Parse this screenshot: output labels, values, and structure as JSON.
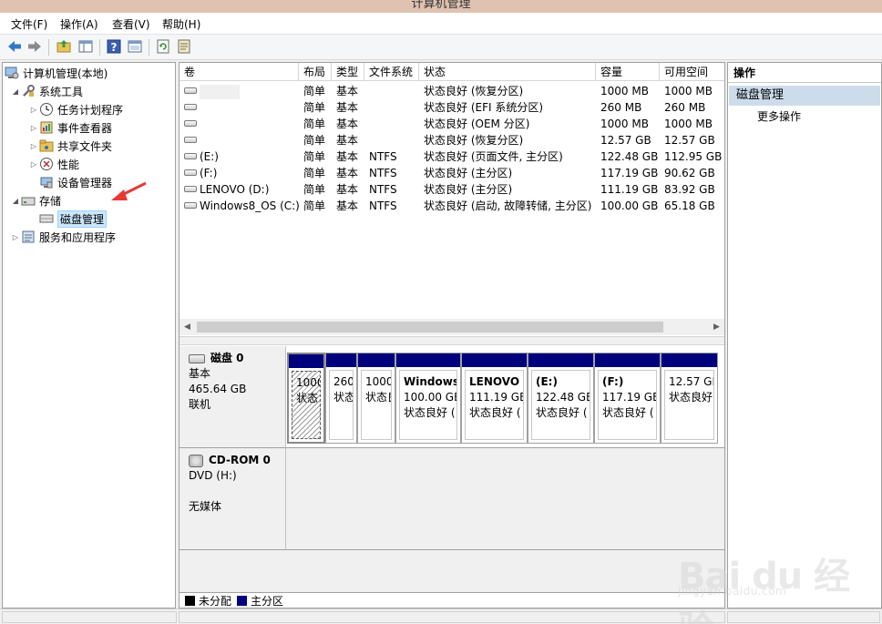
{
  "window": {
    "title": "计算机管理"
  },
  "menu": [
    "文件(F)",
    "操作(A)",
    "查看(V)",
    "帮助(H)"
  ],
  "toolbar": {
    "icons": [
      "back-icon",
      "forward-icon",
      "up-folder-icon",
      "show-hide-tree-icon",
      "help-icon",
      "properties-icon",
      "refresh-icon",
      "export-icon"
    ]
  },
  "tree": {
    "root": "计算机管理(本地)",
    "system_tools": "系统工具",
    "task_scheduler": "任务计划程序",
    "event_viewer": "事件查看器",
    "shared_folders": "共享文件夹",
    "performance": "性能",
    "device_manager": "设备管理器",
    "storage": "存储",
    "disk_management": "磁盘管理",
    "services_apps": "服务和应用程序"
  },
  "volumes": {
    "columns": [
      "卷",
      "布局",
      "类型",
      "文件系统",
      "状态",
      "容量",
      "可用空间"
    ],
    "rows": [
      {
        "name": "",
        "layout": "简单",
        "type": "基本",
        "fs": "",
        "status": "状态良好 (恢复分区)",
        "capacity": "1000 MB",
        "free": "1000 MB"
      },
      {
        "name": "",
        "layout": "简单",
        "type": "基本",
        "fs": "",
        "status": "状态良好 (EFI 系统分区)",
        "capacity": "260 MB",
        "free": "260 MB"
      },
      {
        "name": "",
        "layout": "简单",
        "type": "基本",
        "fs": "",
        "status": "状态良好 (OEM 分区)",
        "capacity": "1000 MB",
        "free": "1000 MB"
      },
      {
        "name": "",
        "layout": "简单",
        "type": "基本",
        "fs": "",
        "status": "状态良好 (恢复分区)",
        "capacity": "12.57 GB",
        "free": "12.57 GB"
      },
      {
        "name": "(E:)",
        "layout": "简单",
        "type": "基本",
        "fs": "NTFS",
        "status": "状态良好 (页面文件, 主分区)",
        "capacity": "122.48 GB",
        "free": "112.95 GB"
      },
      {
        "name": "(F:)",
        "layout": "简单",
        "type": "基本",
        "fs": "NTFS",
        "status": "状态良好 (主分区)",
        "capacity": "117.19 GB",
        "free": "90.62 GB"
      },
      {
        "name": "LENOVO (D:)",
        "layout": "简单",
        "type": "基本",
        "fs": "NTFS",
        "status": "状态良好 (主分区)",
        "capacity": "111.19 GB",
        "free": "83.92 GB"
      },
      {
        "name": "Windows8_OS (C:)",
        "layout": "简单",
        "type": "基本",
        "fs": "NTFS",
        "status": "状态良好 (启动, 故障转储, 主分区)",
        "capacity": "100.00 GB",
        "free": "65.18 GB"
      }
    ]
  },
  "disk0": {
    "name": "磁盘 0",
    "type": "基本",
    "size": "465.64 GB",
    "state": "联机",
    "partitions": [
      {
        "name": "",
        "size": "1000",
        "status": "状态良"
      },
      {
        "name": "",
        "size": "260",
        "status": "状态"
      },
      {
        "name": "",
        "size": "1000",
        "status": "状态良"
      },
      {
        "name": "Windows",
        "size": "100.00 GE",
        "status": "状态良好 ("
      },
      {
        "name": "LENOVO",
        "size": "111.19 GE",
        "status": "状态良好 ("
      },
      {
        "name": "(E:)",
        "size": "122.48 GE",
        "status": "状态良好 ("
      },
      {
        "name": "(F:)",
        "size": "117.19 GE",
        "status": "状态良好 ("
      },
      {
        "name": "",
        "size": "12.57 GI",
        "status": "状态良好"
      }
    ]
  },
  "cdrom": {
    "name": "CD-ROM 0",
    "drive": "DVD (H:)",
    "media": "无媒体"
  },
  "legend": [
    {
      "label": "未分配",
      "color": "#000000"
    },
    {
      "label": "主分区",
      "color": "#00007d"
    }
  ],
  "actions": {
    "header": "操作",
    "section": "磁盘管理",
    "more": "更多操作"
  },
  "watermark": {
    "logo": "Bai du 经验",
    "url": "jingyan.baidu.com"
  },
  "colors": {
    "partition_band": "#00007d",
    "selection": "#cce8ff",
    "action_section": "#cddceb",
    "annotation_arrow": "#e53935"
  }
}
